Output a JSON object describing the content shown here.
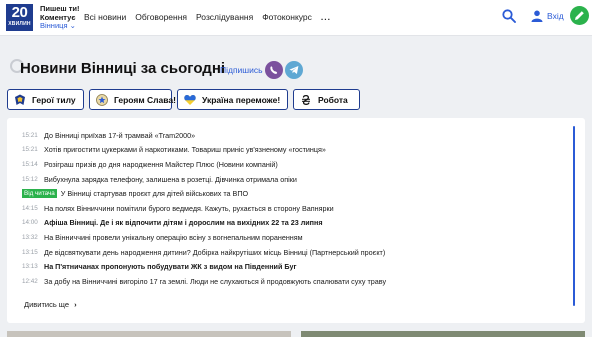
{
  "header": {
    "logo_number": "20",
    "logo_word": "ХВИЛИН",
    "tagline_line1": "Пишеш ти!",
    "tagline_line2": "Коментує",
    "city": "Вінниця ⌄",
    "nav": [
      "Всі новини",
      "Обговорення",
      "Розслідування",
      "Фотоконкурс",
      "..."
    ],
    "login": "Вхід"
  },
  "title": {
    "text": "Новини Вінниці за сьогодні",
    "subscribe": "Підпишись"
  },
  "topics": [
    {
      "label": "Герої тилу",
      "icon": "hero-badge-icon"
    },
    {
      "label": "Героям Слава!",
      "icon": "medal-icon"
    },
    {
      "label": "Україна переможе!",
      "icon": "ukraine-heart-icon"
    },
    {
      "label": "Робота",
      "icon": "hryvnia-icon"
    }
  ],
  "news": [
    {
      "time": "15:21",
      "text": "До Вінниці приїхав 17-й трамвай «Tram2000»",
      "bold": false
    },
    {
      "time": "15:21",
      "text": "Хотів пригостити цукерками й наркотиками. Товариш приніс ув'язненому «гостинця»",
      "bold": false
    },
    {
      "time": "15:14",
      "text": "Розіграш призів до дня народження Майстер Плюс (Новини компаній)",
      "bold": false
    },
    {
      "time": "15:12",
      "text": "Вибухнула зарядка телефону, залишена в розетці. Дівчинка отримала опіки",
      "bold": false
    },
    {
      "time": "",
      "badge": "Від читача",
      "text": "У Вінниці стартував проєкт для дітей військових та ВПО",
      "bold": false
    },
    {
      "time": "14:15",
      "text": "На полях Вінниччини помітили бурого ведмедя. Кажуть, рухається в сторону Вапнярки",
      "bold": false
    },
    {
      "time": "14:00",
      "text": "Афіша Вінниці. Де і як відпочити дітям і дорослим на вихідних 22 та 23 липня",
      "bold": true
    },
    {
      "time": "13:32",
      "text": "На Вінниччині провели унікальну операцію всіну з вогнепальним пораненням",
      "bold": false
    },
    {
      "time": "13:15",
      "text": "Де відсвяткувати день народження дитини? Добірка найкрутіших місць Вінниці (Партнерський проєкт)",
      "bold": false
    },
    {
      "time": "13:13",
      "text": "На П'ятничанах пропонують побудувати ЖК з видом на Південний Буг",
      "bold": true
    },
    {
      "time": "12:42",
      "text": "За добу на Вінниччині вигоріло 17 га землі. Люди не слухаються й продовжують спалювати суху траву",
      "bold": false
    }
  ],
  "more_link": "Дивитись ще",
  "colors": {
    "brand": "#1f3c8f",
    "accent": "#2b5bd6",
    "green": "#2bb24c",
    "viber": "#7b519d",
    "telegram": "#5fa8d3"
  }
}
